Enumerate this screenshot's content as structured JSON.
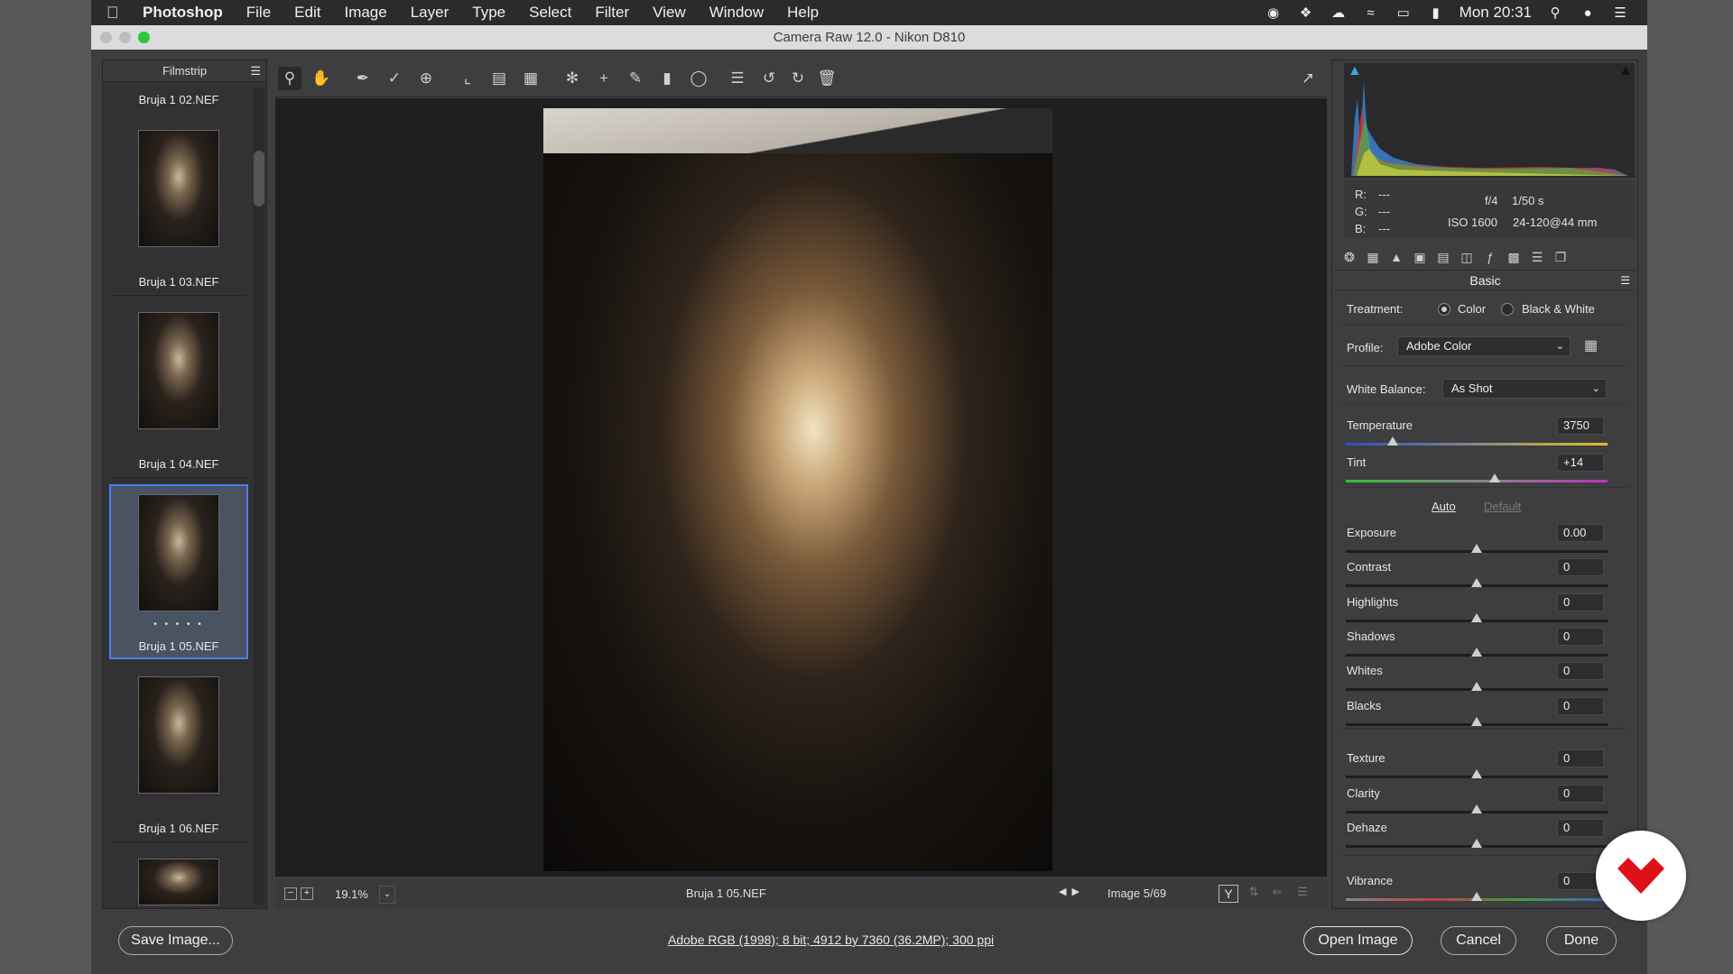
{
  "menubar": {
    "app": "Photoshop",
    "items": [
      "File",
      "Edit",
      "Image",
      "Layer",
      "Type",
      "Select",
      "Filter",
      "View",
      "Window",
      "Help"
    ],
    "clock": "Mon 20:31"
  },
  "window": {
    "title": "Camera Raw 12.0  -  Nikon D810"
  },
  "filmstrip": {
    "title": "Filmstrip",
    "items": [
      {
        "label": "Bruja 1 02.NEF"
      },
      {
        "label": "Bruja 1 03.NEF"
      },
      {
        "label": "Bruja 1 04.NEF"
      },
      {
        "label": "Bruja 1 05.NEF"
      },
      {
        "label": "Bruja 1 06.NEF"
      }
    ],
    "selected_dots": "• • • • •"
  },
  "status": {
    "zoom": "19.1%",
    "filename": "Bruja 1 05.NEF",
    "image_count": "Image 5/69",
    "y_toggle": "Y"
  },
  "camera_info": {
    "r_label": "R:",
    "r_val": "---",
    "g_label": "G:",
    "g_val": "---",
    "b_label": "B:",
    "b_val": "---",
    "aperture": "f/4",
    "shutter": "1/50 s",
    "iso": "ISO 1600",
    "lens": "24-120@44 mm"
  },
  "basic": {
    "title": "Basic",
    "treatment_label": "Treatment:",
    "treatment_color": "Color",
    "treatment_bw": "Black & White",
    "profile_label": "Profile:",
    "profile_value": "Adobe Color",
    "wb_label": "White Balance:",
    "wb_value": "As Shot",
    "auto": "Auto",
    "default": "Default",
    "sliders": [
      {
        "label": "Temperature",
        "value": "3750",
        "level": 0.18
      },
      {
        "label": "Tint",
        "value": "+14",
        "level": 0.57
      },
      {
        "label": "Exposure",
        "value": "0.00",
        "level": 0.5
      },
      {
        "label": "Contrast",
        "value": "0",
        "level": 0.5
      },
      {
        "label": "Highlights",
        "value": "0",
        "level": 0.5
      },
      {
        "label": "Shadows",
        "value": "0",
        "level": 0.5
      },
      {
        "label": "Whites",
        "value": "0",
        "level": 0.5
      },
      {
        "label": "Blacks",
        "value": "0",
        "level": 0.5
      },
      {
        "label": "Texture",
        "value": "0",
        "level": 0.5
      },
      {
        "label": "Clarity",
        "value": "0",
        "level": 0.5
      },
      {
        "label": "Dehaze",
        "value": "0",
        "level": 0.5
      },
      {
        "label": "Vibrance",
        "value": "0",
        "level": 0.5
      }
    ]
  },
  "bottom": {
    "save": "Save Image...",
    "info": "Adobe RGB (1998); 8 bit; 4912 by 7360 (36.2MP); 300 ppi",
    "open": "Open Image",
    "cancel": "Cancel",
    "done": "Done"
  },
  "colors": {
    "selection": "#4a7ef0",
    "logo_red": "#e0101a"
  }
}
